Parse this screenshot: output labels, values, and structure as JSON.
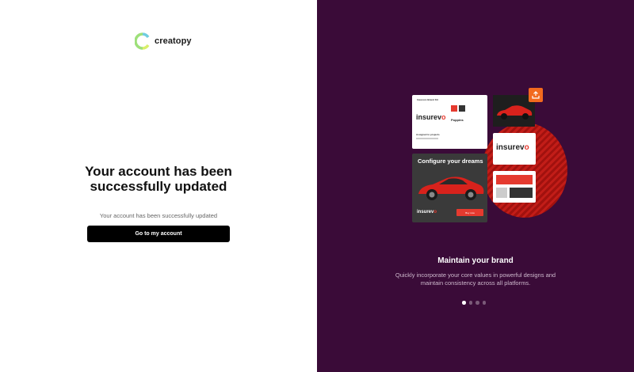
{
  "brand": {
    "name": "creatopy"
  },
  "main": {
    "title_line1": "Your account has been",
    "title_line2": "successfully updated",
    "message": "Your account has been successfully updated",
    "button_label": "Go to my account"
  },
  "illustration": {
    "brand_kit_header": "Insurevo Brand Kit",
    "brand_wordmark_main": "insurev",
    "brand_wordmark_accent": "o",
    "font_name": "Poppins",
    "assigned_label": "Assigned to projects",
    "ad_headline": "Configure your dreams",
    "ad_cta": "Buy now"
  },
  "slide": {
    "title": "Maintain your brand",
    "description": "Quickly incorporate your core values in powerful designs and maintain consistency across all platforms.",
    "dots": [
      true,
      false,
      false,
      false
    ]
  },
  "colors": {
    "panel_bg": "#3a0b38",
    "accent": "#e53a2f",
    "button_bg": "#000000"
  }
}
